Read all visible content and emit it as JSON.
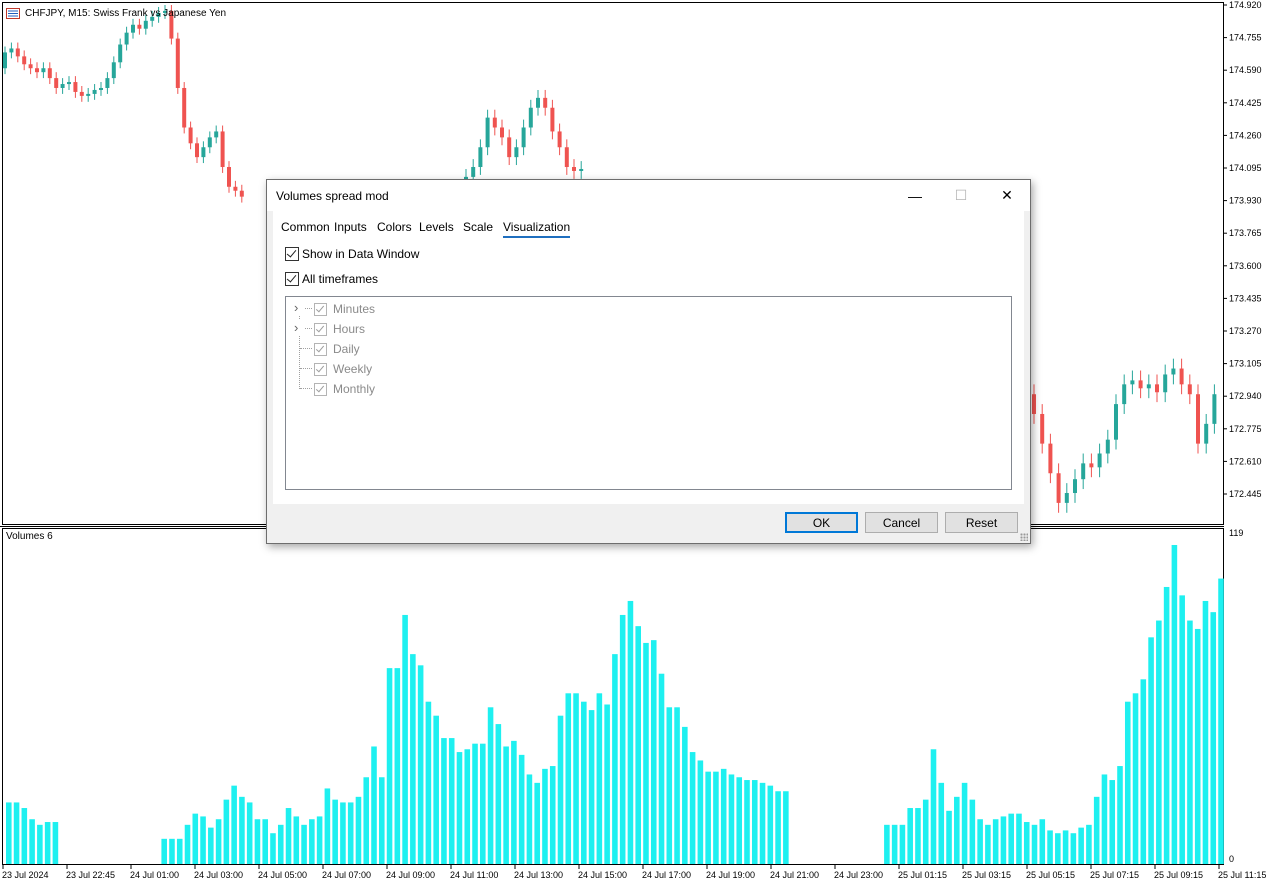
{
  "chart": {
    "symbol_title": "CHFJPY, M15:  Swiss Frank vs Japanese Yen",
    "volume_title": "Volumes 6",
    "price_labels": [
      "174.920",
      "174.755",
      "174.590",
      "174.425",
      "174.260",
      "174.095",
      "173.930",
      "173.765",
      "173.600",
      "173.435",
      "173.270",
      "173.105",
      "172.940",
      "172.775",
      "172.610",
      "172.445"
    ],
    "volume_labels": [
      "119",
      "0"
    ],
    "time_labels": [
      "23 Jul 2024",
      "23 Jul 22:45",
      "24 Jul 01:00",
      "24 Jul 03:00",
      "24 Jul 05:00",
      "24 Jul 07:00",
      "24 Jul 09:00",
      "24 Jul 11:00",
      "24 Jul 13:00",
      "24 Jul 15:00",
      "24 Jul 17:00",
      "24 Jul 19:00",
      "24 Jul 21:00",
      "24 Jul 23:00",
      "25 Jul 01:15",
      "25 Jul 03:15",
      "25 Jul 05:15",
      "25 Jul 07:15",
      "25 Jul 09:15",
      "25 Jul 11:15"
    ],
    "colors": {
      "bull": "#26a69a",
      "bear": "#ef5350",
      "volume": "#1ef0f0",
      "axis": "#000000"
    }
  },
  "dialog": {
    "title": "Volumes spread mod",
    "tabs": [
      "Common",
      "Inputs",
      "Colors",
      "Levels",
      "Scale",
      "Visualization"
    ],
    "active_tab": "Visualization",
    "show_in_data_window": "Show in Data Window",
    "all_timeframes": "All timeframes",
    "tree": [
      "Minutes",
      "Hours",
      "Daily",
      "Weekly",
      "Monthly"
    ],
    "buttons": {
      "ok": "OK",
      "cancel": "Cancel",
      "reset": "Reset"
    },
    "win_min": "—",
    "win_max": "☐",
    "win_close": "✕"
  }
}
